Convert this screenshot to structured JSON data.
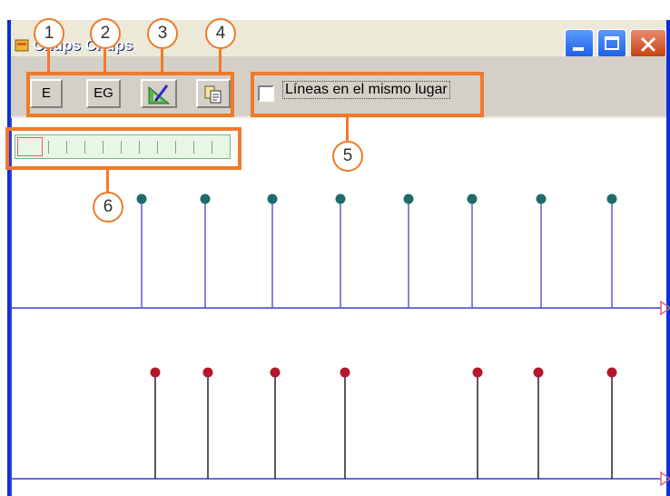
{
  "window": {
    "title": "Chups Chups"
  },
  "toolbar": {
    "e_label": "E",
    "eg_label": "EG",
    "draw_icon": "ruler-pencil-icon",
    "copy_icon": "copy-clipboard-icon",
    "checkbox_label": "Líneas en el mismo lugar",
    "checkbox_checked": false
  },
  "callouts": [
    "1",
    "2",
    "3",
    "4",
    "5",
    "6"
  ],
  "colors": {
    "highlight": "#f07a2b",
    "top_marker": "#1e6b6e",
    "top_stem": "#5a5ad8",
    "bottom_marker": "#b3182a",
    "bottom_stem": "#222222",
    "axis": "#3b3bd6"
  }
}
